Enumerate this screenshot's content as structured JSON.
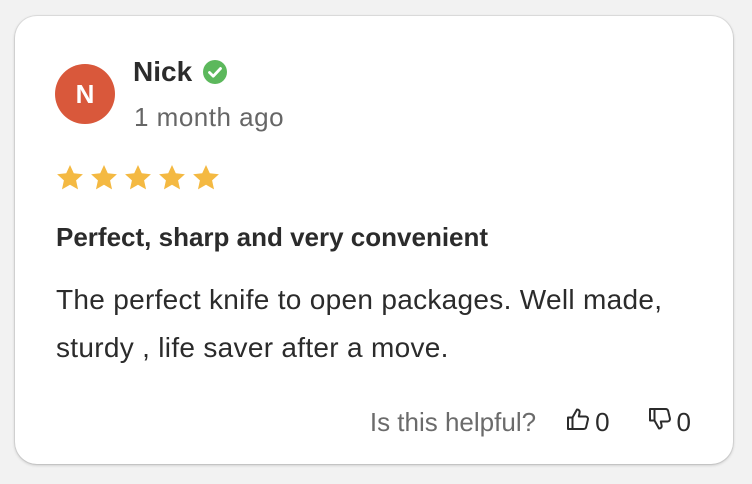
{
  "review": {
    "avatar_initial": "N",
    "author": "Nick",
    "verified_icon": "check-circle-icon",
    "time_ago": "1 month ago",
    "rating": 5,
    "rating_max": 5,
    "title": "Perfect, sharp and very convenient",
    "body": "The perfect knife to open packages. Well made, sturdy , life saver after a move.",
    "helpful_prompt": "Is this helpful?",
    "thumbs_up_count": "0",
    "thumbs_down_count": "0"
  },
  "colors": {
    "avatar_bg": "#d9583b",
    "verified": "#5cb85c",
    "star": "#f4b942"
  }
}
